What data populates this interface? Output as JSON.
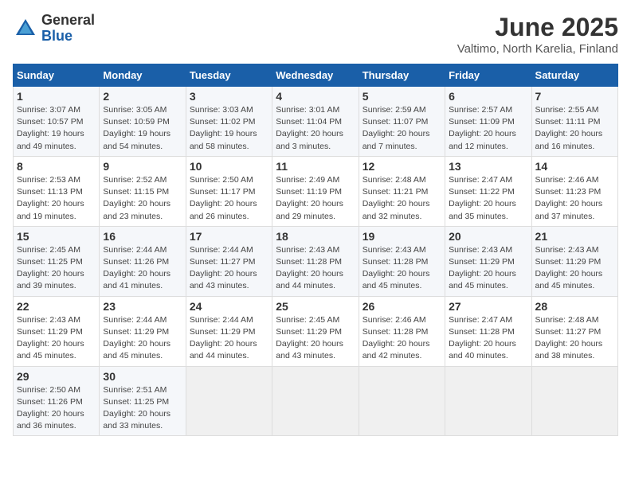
{
  "logo": {
    "general": "General",
    "blue": "Blue"
  },
  "title": "June 2025",
  "location": "Valtimo, North Karelia, Finland",
  "headers": [
    "Sunday",
    "Monday",
    "Tuesday",
    "Wednesday",
    "Thursday",
    "Friday",
    "Saturday"
  ],
  "weeks": [
    [
      {
        "day": "1",
        "info": "Sunrise: 3:07 AM\nSunset: 10:57 PM\nDaylight: 19 hours\nand 49 minutes."
      },
      {
        "day": "2",
        "info": "Sunrise: 3:05 AM\nSunset: 10:59 PM\nDaylight: 19 hours\nand 54 minutes."
      },
      {
        "day": "3",
        "info": "Sunrise: 3:03 AM\nSunset: 11:02 PM\nDaylight: 19 hours\nand 58 minutes."
      },
      {
        "day": "4",
        "info": "Sunrise: 3:01 AM\nSunset: 11:04 PM\nDaylight: 20 hours\nand 3 minutes."
      },
      {
        "day": "5",
        "info": "Sunrise: 2:59 AM\nSunset: 11:07 PM\nDaylight: 20 hours\nand 7 minutes."
      },
      {
        "day": "6",
        "info": "Sunrise: 2:57 AM\nSunset: 11:09 PM\nDaylight: 20 hours\nand 12 minutes."
      },
      {
        "day": "7",
        "info": "Sunrise: 2:55 AM\nSunset: 11:11 PM\nDaylight: 20 hours\nand 16 minutes."
      }
    ],
    [
      {
        "day": "8",
        "info": "Sunrise: 2:53 AM\nSunset: 11:13 PM\nDaylight: 20 hours\nand 19 minutes."
      },
      {
        "day": "9",
        "info": "Sunrise: 2:52 AM\nSunset: 11:15 PM\nDaylight: 20 hours\nand 23 minutes."
      },
      {
        "day": "10",
        "info": "Sunrise: 2:50 AM\nSunset: 11:17 PM\nDaylight: 20 hours\nand 26 minutes."
      },
      {
        "day": "11",
        "info": "Sunrise: 2:49 AM\nSunset: 11:19 PM\nDaylight: 20 hours\nand 29 minutes."
      },
      {
        "day": "12",
        "info": "Sunrise: 2:48 AM\nSunset: 11:21 PM\nDaylight: 20 hours\nand 32 minutes."
      },
      {
        "day": "13",
        "info": "Sunrise: 2:47 AM\nSunset: 11:22 PM\nDaylight: 20 hours\nand 35 minutes."
      },
      {
        "day": "14",
        "info": "Sunrise: 2:46 AM\nSunset: 11:23 PM\nDaylight: 20 hours\nand 37 minutes."
      }
    ],
    [
      {
        "day": "15",
        "info": "Sunrise: 2:45 AM\nSunset: 11:25 PM\nDaylight: 20 hours\nand 39 minutes."
      },
      {
        "day": "16",
        "info": "Sunrise: 2:44 AM\nSunset: 11:26 PM\nDaylight: 20 hours\nand 41 minutes."
      },
      {
        "day": "17",
        "info": "Sunrise: 2:44 AM\nSunset: 11:27 PM\nDaylight: 20 hours\nand 43 minutes."
      },
      {
        "day": "18",
        "info": "Sunrise: 2:43 AM\nSunset: 11:28 PM\nDaylight: 20 hours\nand 44 minutes."
      },
      {
        "day": "19",
        "info": "Sunrise: 2:43 AM\nSunset: 11:28 PM\nDaylight: 20 hours\nand 45 minutes."
      },
      {
        "day": "20",
        "info": "Sunrise: 2:43 AM\nSunset: 11:29 PM\nDaylight: 20 hours\nand 45 minutes."
      },
      {
        "day": "21",
        "info": "Sunrise: 2:43 AM\nSunset: 11:29 PM\nDaylight: 20 hours\nand 45 minutes."
      }
    ],
    [
      {
        "day": "22",
        "info": "Sunrise: 2:43 AM\nSunset: 11:29 PM\nDaylight: 20 hours\nand 45 minutes."
      },
      {
        "day": "23",
        "info": "Sunrise: 2:44 AM\nSunset: 11:29 PM\nDaylight: 20 hours\nand 45 minutes."
      },
      {
        "day": "24",
        "info": "Sunrise: 2:44 AM\nSunset: 11:29 PM\nDaylight: 20 hours\nand 44 minutes."
      },
      {
        "day": "25",
        "info": "Sunrise: 2:45 AM\nSunset: 11:29 PM\nDaylight: 20 hours\nand 43 minutes."
      },
      {
        "day": "26",
        "info": "Sunrise: 2:46 AM\nSunset: 11:28 PM\nDaylight: 20 hours\nand 42 minutes."
      },
      {
        "day": "27",
        "info": "Sunrise: 2:47 AM\nSunset: 11:28 PM\nDaylight: 20 hours\nand 40 minutes."
      },
      {
        "day": "28",
        "info": "Sunrise: 2:48 AM\nSunset: 11:27 PM\nDaylight: 20 hours\nand 38 minutes."
      }
    ],
    [
      {
        "day": "29",
        "info": "Sunrise: 2:50 AM\nSunset: 11:26 PM\nDaylight: 20 hours\nand 36 minutes."
      },
      {
        "day": "30",
        "info": "Sunrise: 2:51 AM\nSunset: 11:25 PM\nDaylight: 20 hours\nand 33 minutes."
      },
      null,
      null,
      null,
      null,
      null
    ]
  ]
}
